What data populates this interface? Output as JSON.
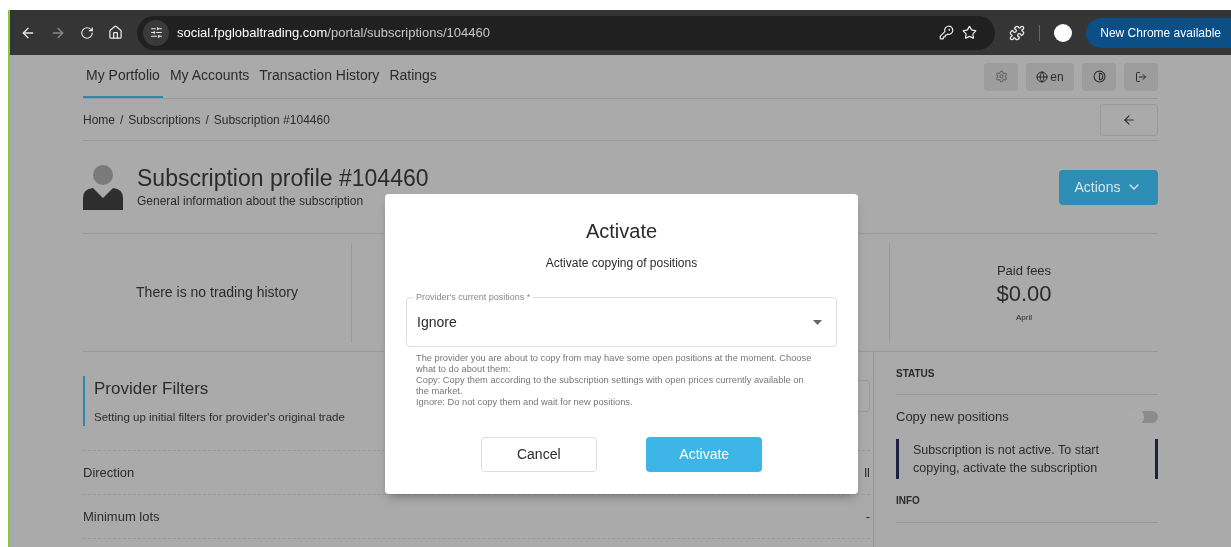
{
  "browser": {
    "url_host": "social.fpglobaltrading.com",
    "url_path": "/portal/subscriptions/104460",
    "update_button": "New Chrome available"
  },
  "nav": {
    "tabs": [
      {
        "label": "My Portfolio",
        "selected": true
      },
      {
        "label": "My Accounts",
        "selected": false
      },
      {
        "label": "Transaction History",
        "selected": false
      },
      {
        "label": "Ratings",
        "selected": false
      }
    ],
    "language": "en"
  },
  "breadcrumb": {
    "separator": "/",
    "items": [
      "Home",
      "Subscriptions",
      "Subscription #104460"
    ]
  },
  "header": {
    "title": "Subscription profile #104460",
    "subtitle": "General information about the subscription",
    "actions_button": "Actions"
  },
  "stats": {
    "no_history": "There is no trading history",
    "fees_label": "Paid fees",
    "fees_value": "$0.00",
    "fees_period": "April"
  },
  "filters": {
    "title": "Provider Filters",
    "subtitle": "Setting up initial filters for provider's original trade",
    "rows": [
      {
        "label": "Direction",
        "value": "ll"
      },
      {
        "label": "Minimum lots",
        "value": "-"
      }
    ]
  },
  "status": {
    "heading": "STATUS",
    "toggle_label": "Copy new positions",
    "toggle_on": false,
    "notice": "Subscription is not active. To start copying, activate the subscription",
    "info_heading": "INFO"
  },
  "modal": {
    "title": "Activate",
    "subtitle": "Activate copying of positions",
    "field_label": "Provider's current positions *",
    "field_value": "Ignore",
    "help": [
      "The provider you are about to copy from may have some open positions at the moment. Choose what to do about them:",
      "Copy: Copy them according to the subscription settings with open prices currently available on the market.",
      "Ignore: Do not copy them and wait for new positions."
    ],
    "cancel": "Cancel",
    "confirm": "Activate"
  }
}
